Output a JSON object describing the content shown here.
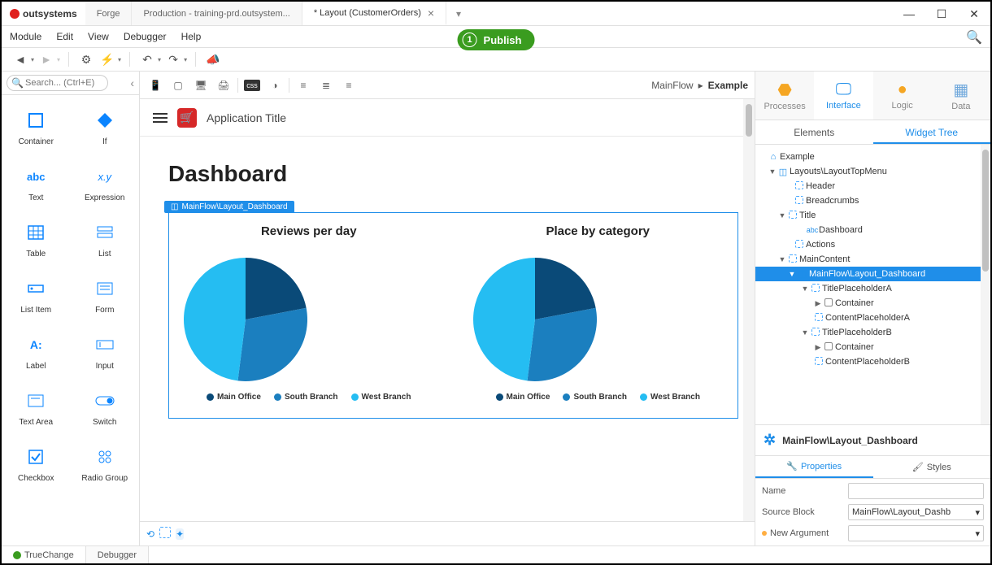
{
  "brand": "outsystems",
  "tabs": [
    {
      "label": "Forge",
      "active": false,
      "closable": false
    },
    {
      "label": "Production - training-prd.outsystem...",
      "active": false,
      "closable": false
    },
    {
      "label": "* Layout (CustomerOrders)",
      "active": true,
      "closable": true
    }
  ],
  "menus": [
    "Module",
    "Edit",
    "View",
    "Debugger",
    "Help"
  ],
  "publish": {
    "step": "1",
    "label": "Publish"
  },
  "search": {
    "placeholder": "Search... (Ctrl+E)"
  },
  "palette": [
    {
      "label": "Container",
      "icon": "container"
    },
    {
      "label": "If",
      "icon": "if"
    },
    {
      "label": "Text",
      "icon": "text"
    },
    {
      "label": "Expression",
      "icon": "expr"
    },
    {
      "label": "Table",
      "icon": "table"
    },
    {
      "label": "List",
      "icon": "list"
    },
    {
      "label": "List Item",
      "icon": "listitem"
    },
    {
      "label": "Form",
      "icon": "form"
    },
    {
      "label": "Label",
      "icon": "label"
    },
    {
      "label": "Input",
      "icon": "input"
    },
    {
      "label": "Text Area",
      "icon": "textarea"
    },
    {
      "label": "Switch",
      "icon": "switch"
    },
    {
      "label": "Checkbox",
      "icon": "checkbox"
    },
    {
      "label": "Radio Group",
      "icon": "radio"
    }
  ],
  "breadcrumb": {
    "parent": "MainFlow",
    "current": "Example"
  },
  "app_title": "Application Title",
  "dashboard_title": "Dashboard",
  "block_tag": "MainFlow\\Layout_Dashboard",
  "chart_titles": {
    "left": "Reviews per day",
    "right": "Place by category"
  },
  "legend": [
    "Main Office",
    "South Branch",
    "West Branch"
  ],
  "chart_data": [
    {
      "type": "pie",
      "title": "Reviews per day",
      "series": [
        {
          "name": "Main Office",
          "value": 22,
          "color": "#0a4a78"
        },
        {
          "name": "South Branch",
          "value": 30,
          "color": "#1b7fbf"
        },
        {
          "name": "West Branch",
          "value": 48,
          "color": "#25bdf2"
        }
      ]
    },
    {
      "type": "pie",
      "title": "Place by category",
      "series": [
        {
          "name": "Main Office",
          "value": 22,
          "color": "#0a4a78"
        },
        {
          "name": "South Branch",
          "value": 30,
          "color": "#1b7fbf"
        },
        {
          "name": "West Branch",
          "value": 48,
          "color": "#25bdf2"
        }
      ]
    }
  ],
  "right_tabs": [
    "Processes",
    "Interface",
    "Logic",
    "Data"
  ],
  "right_subtabs": [
    "Elements",
    "Widget Tree"
  ],
  "tree": [
    {
      "pad": 4,
      "arr": "",
      "ic": "home",
      "label": "Example"
    },
    {
      "pad": 16,
      "arr": "▼",
      "ic": "block",
      "label": "Layouts\\LayoutTopMenu"
    },
    {
      "pad": 36,
      "arr": "",
      "ic": "ph",
      "label": "Header"
    },
    {
      "pad": 36,
      "arr": "",
      "ic": "ph",
      "label": "Breadcrumbs"
    },
    {
      "pad": 28,
      "arr": "▼",
      "ic": "ph",
      "label": "Title"
    },
    {
      "pad": 52,
      "arr": "",
      "ic": "abc",
      "label": "Dashboard"
    },
    {
      "pad": 36,
      "arr": "",
      "ic": "ph",
      "label": "Actions"
    },
    {
      "pad": 28,
      "arr": "▼",
      "ic": "ph",
      "label": "MainContent"
    },
    {
      "pad": 40,
      "arr": "▼",
      "ic": "block",
      "label": "MainFlow\\Layout_Dashboard",
      "sel": true
    },
    {
      "pad": 56,
      "arr": "▼",
      "ic": "ph",
      "label": "TitlePlaceholderA"
    },
    {
      "pad": 72,
      "arr": "▶",
      "ic": "cont",
      "label": "Container"
    },
    {
      "pad": 60,
      "arr": "",
      "ic": "ph",
      "label": "ContentPlaceholderA"
    },
    {
      "pad": 56,
      "arr": "▼",
      "ic": "ph",
      "label": "TitlePlaceholderB"
    },
    {
      "pad": 72,
      "arr": "▶",
      "ic": "cont",
      "label": "Container"
    },
    {
      "pad": 60,
      "arr": "",
      "ic": "ph",
      "label": "ContentPlaceholderB"
    }
  ],
  "selected_block": "MainFlow\\Layout_Dashboard",
  "props_tabs": [
    "Properties",
    "Styles"
  ],
  "props": {
    "name": {
      "label": "Name",
      "value": ""
    },
    "source": {
      "label": "Source Block",
      "value": "MainFlow\\Layout_Dashb"
    },
    "newarg": {
      "label": "New Argument",
      "value": ""
    }
  },
  "status": [
    "TrueChange",
    "Debugger"
  ]
}
